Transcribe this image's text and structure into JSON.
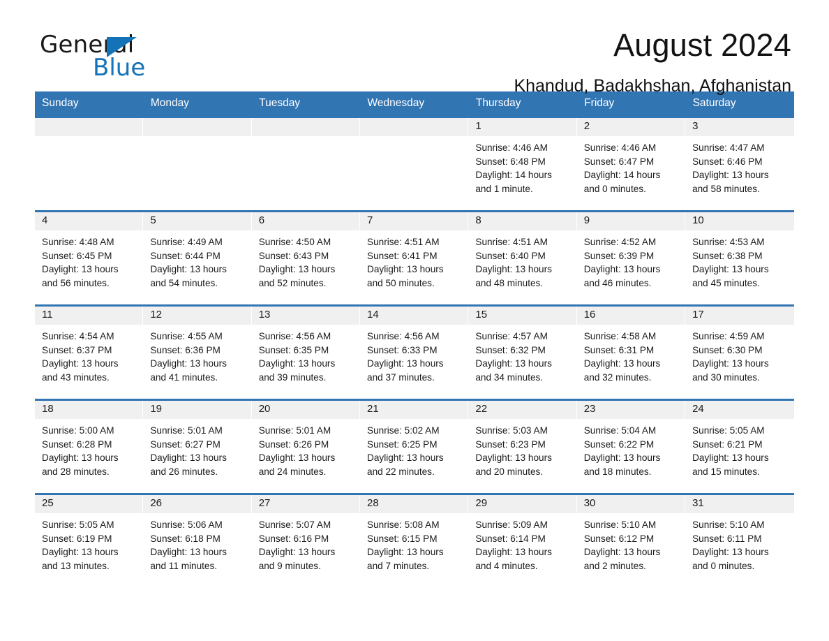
{
  "brand": {
    "line1": "General",
    "line2": "Blue",
    "triangle_color": "#1473b8"
  },
  "header": {
    "title": "August 2024",
    "subtitle": "Khandud, Badakhshan, Afghanistan"
  },
  "theme": {
    "header_blue": "#3275b3",
    "daynum_band": "#f0f0f0",
    "text": "#1b1b1b"
  },
  "calendar": {
    "weekday_headers": [
      "Sunday",
      "Monday",
      "Tuesday",
      "Wednesday",
      "Thursday",
      "Friday",
      "Saturday"
    ],
    "weeks": [
      [
        {
          "day": "",
          "sunrise": "",
          "sunset": "",
          "daylight_line1": "",
          "daylight_line2": "",
          "empty": true
        },
        {
          "day": "",
          "sunrise": "",
          "sunset": "",
          "daylight_line1": "",
          "daylight_line2": "",
          "empty": true
        },
        {
          "day": "",
          "sunrise": "",
          "sunset": "",
          "daylight_line1": "",
          "daylight_line2": "",
          "empty": true
        },
        {
          "day": "",
          "sunrise": "",
          "sunset": "",
          "daylight_line1": "",
          "daylight_line2": "",
          "empty": true
        },
        {
          "day": "1",
          "sunrise": "Sunrise: 4:46 AM",
          "sunset": "Sunset: 6:48 PM",
          "daylight_line1": "Daylight: 14 hours",
          "daylight_line2": "and 1 minute."
        },
        {
          "day": "2",
          "sunrise": "Sunrise: 4:46 AM",
          "sunset": "Sunset: 6:47 PM",
          "daylight_line1": "Daylight: 14 hours",
          "daylight_line2": "and 0 minutes."
        },
        {
          "day": "3",
          "sunrise": "Sunrise: 4:47 AM",
          "sunset": "Sunset: 6:46 PM",
          "daylight_line1": "Daylight: 13 hours",
          "daylight_line2": "and 58 minutes."
        }
      ],
      [
        {
          "day": "4",
          "sunrise": "Sunrise: 4:48 AM",
          "sunset": "Sunset: 6:45 PM",
          "daylight_line1": "Daylight: 13 hours",
          "daylight_line2": "and 56 minutes."
        },
        {
          "day": "5",
          "sunrise": "Sunrise: 4:49 AM",
          "sunset": "Sunset: 6:44 PM",
          "daylight_line1": "Daylight: 13 hours",
          "daylight_line2": "and 54 minutes."
        },
        {
          "day": "6",
          "sunrise": "Sunrise: 4:50 AM",
          "sunset": "Sunset: 6:43 PM",
          "daylight_line1": "Daylight: 13 hours",
          "daylight_line2": "and 52 minutes."
        },
        {
          "day": "7",
          "sunrise": "Sunrise: 4:51 AM",
          "sunset": "Sunset: 6:41 PM",
          "daylight_line1": "Daylight: 13 hours",
          "daylight_line2": "and 50 minutes."
        },
        {
          "day": "8",
          "sunrise": "Sunrise: 4:51 AM",
          "sunset": "Sunset: 6:40 PM",
          "daylight_line1": "Daylight: 13 hours",
          "daylight_line2": "and 48 minutes."
        },
        {
          "day": "9",
          "sunrise": "Sunrise: 4:52 AM",
          "sunset": "Sunset: 6:39 PM",
          "daylight_line1": "Daylight: 13 hours",
          "daylight_line2": "and 46 minutes."
        },
        {
          "day": "10",
          "sunrise": "Sunrise: 4:53 AM",
          "sunset": "Sunset: 6:38 PM",
          "daylight_line1": "Daylight: 13 hours",
          "daylight_line2": "and 45 minutes."
        }
      ],
      [
        {
          "day": "11",
          "sunrise": "Sunrise: 4:54 AM",
          "sunset": "Sunset: 6:37 PM",
          "daylight_line1": "Daylight: 13 hours",
          "daylight_line2": "and 43 minutes."
        },
        {
          "day": "12",
          "sunrise": "Sunrise: 4:55 AM",
          "sunset": "Sunset: 6:36 PM",
          "daylight_line1": "Daylight: 13 hours",
          "daylight_line2": "and 41 minutes."
        },
        {
          "day": "13",
          "sunrise": "Sunrise: 4:56 AM",
          "sunset": "Sunset: 6:35 PM",
          "daylight_line1": "Daylight: 13 hours",
          "daylight_line2": "and 39 minutes."
        },
        {
          "day": "14",
          "sunrise": "Sunrise: 4:56 AM",
          "sunset": "Sunset: 6:33 PM",
          "daylight_line1": "Daylight: 13 hours",
          "daylight_line2": "and 37 minutes."
        },
        {
          "day": "15",
          "sunrise": "Sunrise: 4:57 AM",
          "sunset": "Sunset: 6:32 PM",
          "daylight_line1": "Daylight: 13 hours",
          "daylight_line2": "and 34 minutes."
        },
        {
          "day": "16",
          "sunrise": "Sunrise: 4:58 AM",
          "sunset": "Sunset: 6:31 PM",
          "daylight_line1": "Daylight: 13 hours",
          "daylight_line2": "and 32 minutes."
        },
        {
          "day": "17",
          "sunrise": "Sunrise: 4:59 AM",
          "sunset": "Sunset: 6:30 PM",
          "daylight_line1": "Daylight: 13 hours",
          "daylight_line2": "and 30 minutes."
        }
      ],
      [
        {
          "day": "18",
          "sunrise": "Sunrise: 5:00 AM",
          "sunset": "Sunset: 6:28 PM",
          "daylight_line1": "Daylight: 13 hours",
          "daylight_line2": "and 28 minutes."
        },
        {
          "day": "19",
          "sunrise": "Sunrise: 5:01 AM",
          "sunset": "Sunset: 6:27 PM",
          "daylight_line1": "Daylight: 13 hours",
          "daylight_line2": "and 26 minutes."
        },
        {
          "day": "20",
          "sunrise": "Sunrise: 5:01 AM",
          "sunset": "Sunset: 6:26 PM",
          "daylight_line1": "Daylight: 13 hours",
          "daylight_line2": "and 24 minutes."
        },
        {
          "day": "21",
          "sunrise": "Sunrise: 5:02 AM",
          "sunset": "Sunset: 6:25 PM",
          "daylight_line1": "Daylight: 13 hours",
          "daylight_line2": "and 22 minutes."
        },
        {
          "day": "22",
          "sunrise": "Sunrise: 5:03 AM",
          "sunset": "Sunset: 6:23 PM",
          "daylight_line1": "Daylight: 13 hours",
          "daylight_line2": "and 20 minutes."
        },
        {
          "day": "23",
          "sunrise": "Sunrise: 5:04 AM",
          "sunset": "Sunset: 6:22 PM",
          "daylight_line1": "Daylight: 13 hours",
          "daylight_line2": "and 18 minutes."
        },
        {
          "day": "24",
          "sunrise": "Sunrise: 5:05 AM",
          "sunset": "Sunset: 6:21 PM",
          "daylight_line1": "Daylight: 13 hours",
          "daylight_line2": "and 15 minutes."
        }
      ],
      [
        {
          "day": "25",
          "sunrise": "Sunrise: 5:05 AM",
          "sunset": "Sunset: 6:19 PM",
          "daylight_line1": "Daylight: 13 hours",
          "daylight_line2": "and 13 minutes."
        },
        {
          "day": "26",
          "sunrise": "Sunrise: 5:06 AM",
          "sunset": "Sunset: 6:18 PM",
          "daylight_line1": "Daylight: 13 hours",
          "daylight_line2": "and 11 minutes."
        },
        {
          "day": "27",
          "sunrise": "Sunrise: 5:07 AM",
          "sunset": "Sunset: 6:16 PM",
          "daylight_line1": "Daylight: 13 hours",
          "daylight_line2": "and 9 minutes."
        },
        {
          "day": "28",
          "sunrise": "Sunrise: 5:08 AM",
          "sunset": "Sunset: 6:15 PM",
          "daylight_line1": "Daylight: 13 hours",
          "daylight_line2": "and 7 minutes."
        },
        {
          "day": "29",
          "sunrise": "Sunrise: 5:09 AM",
          "sunset": "Sunset: 6:14 PM",
          "daylight_line1": "Daylight: 13 hours",
          "daylight_line2": "and 4 minutes."
        },
        {
          "day": "30",
          "sunrise": "Sunrise: 5:10 AM",
          "sunset": "Sunset: 6:12 PM",
          "daylight_line1": "Daylight: 13 hours",
          "daylight_line2": "and 2 minutes."
        },
        {
          "day": "31",
          "sunrise": "Sunrise: 5:10 AM",
          "sunset": "Sunset: 6:11 PM",
          "daylight_line1": "Daylight: 13 hours",
          "daylight_line2": "and 0 minutes."
        }
      ]
    ]
  }
}
